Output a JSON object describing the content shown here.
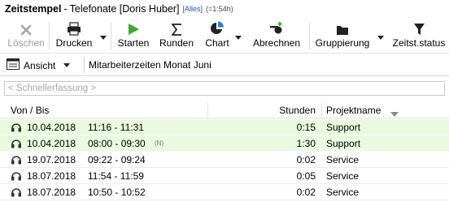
{
  "window": {
    "app": "Zeitstempel",
    "separator": "-",
    "document": "Telefonate [Doris Huber]",
    "filter_badge": "[Alles]",
    "total_badge": "(=1:54h)"
  },
  "toolbar": {
    "delete_label": "Löschen",
    "print_label": "Drucken",
    "start_label": "Starten",
    "round_label": "Runden",
    "chart_label": "Chart",
    "bill_label": "Abrechnen",
    "group_label": "Gruppierung",
    "status_label": "Zeitst.status"
  },
  "viewbar": {
    "view_label": "Ansicht",
    "title": "Mitarbeiterzeiten Monat Juni"
  },
  "quick_entry": {
    "placeholder": "< Schnellerfassung >"
  },
  "table": {
    "columns": [
      "Von / Bis",
      "Stunden",
      "Projektname"
    ],
    "rows": [
      {
        "date": "10.04.2018",
        "time": "11:16 - 11:31",
        "note": "",
        "hours": "0:15",
        "project": "Support",
        "highlight": true
      },
      {
        "date": "10.04.2018",
        "time": "08:00 - 09:30",
        "note": "(N)",
        "hours": "1:30",
        "project": "Support",
        "highlight": true
      },
      {
        "date": "19.07.2018",
        "time": "09:22 - 09:24",
        "note": "",
        "hours": "0:02",
        "project": "Service",
        "highlight": false
      },
      {
        "date": "18.07.2018",
        "time": "11:54 - 11:59",
        "note": "",
        "hours": "0:05",
        "project": "Service",
        "highlight": false
      },
      {
        "date": "18.07.2018",
        "time": "10:50 - 10:52",
        "note": "",
        "hours": "0:02",
        "project": "Service",
        "highlight": false
      }
    ]
  },
  "colors": {
    "highlight_row": "#e9fadf",
    "filter_badge": "#1f50c8",
    "start_icon": "#3cab2e"
  },
  "icons": {
    "delete": "close-icon",
    "print": "printer-icon",
    "start": "play-icon",
    "round": "sigma-icon",
    "chart": "pie-chart-icon",
    "bill": "billing-icon",
    "group": "folder-icon",
    "status": "filter-icon",
    "view": "view-icon",
    "row": "phone-headset-icon",
    "sort": "sort-descending-icon"
  }
}
